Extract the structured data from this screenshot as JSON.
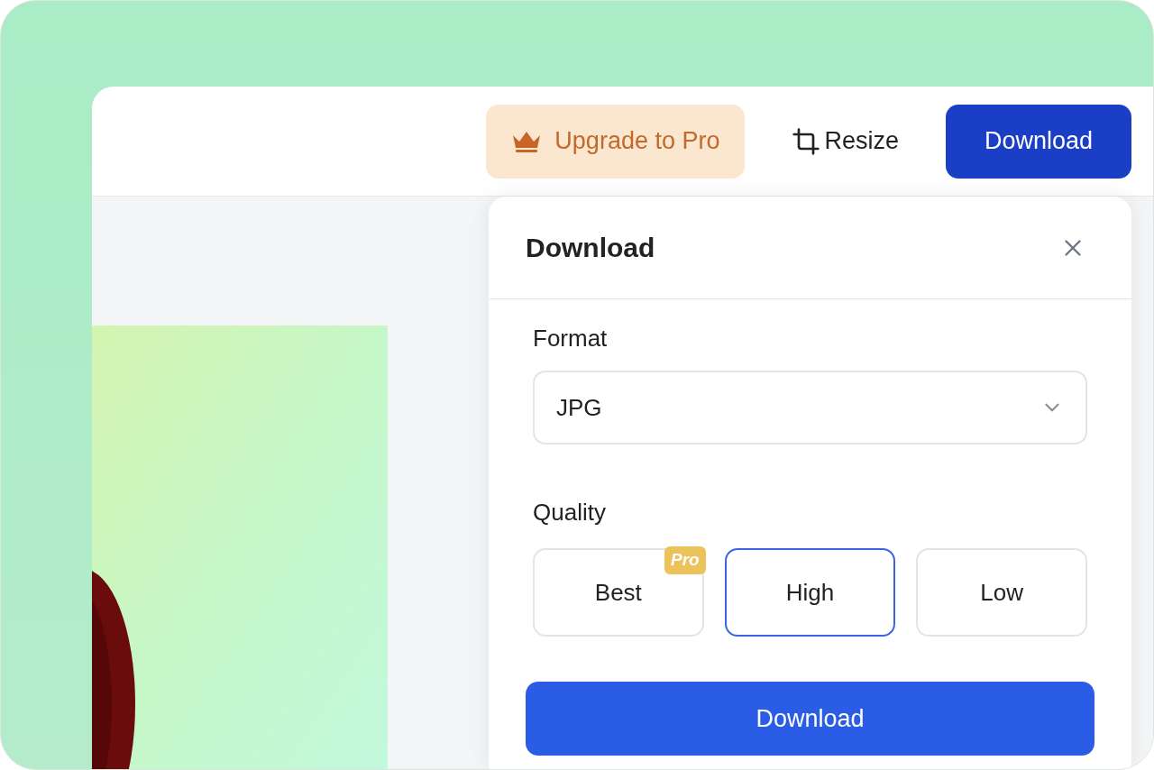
{
  "topbar": {
    "buttons": [
      {
        "kind": "upgrade",
        "label": "Upgrade to Pro"
      },
      {
        "kind": "resize",
        "label": "Resize"
      },
      {
        "kind": "primary",
        "label": "Download"
      }
    ]
  },
  "dialog": {
    "title": "Download",
    "format": {
      "label": "Format",
      "value": "JPG"
    },
    "quality": {
      "label": "Quality",
      "options": [
        {
          "label": "Best",
          "badge": "Pro",
          "selected": false
        },
        {
          "label": "High",
          "selected": true
        },
        {
          "label": "Low",
          "selected": false
        }
      ]
    },
    "submit": "Download"
  }
}
